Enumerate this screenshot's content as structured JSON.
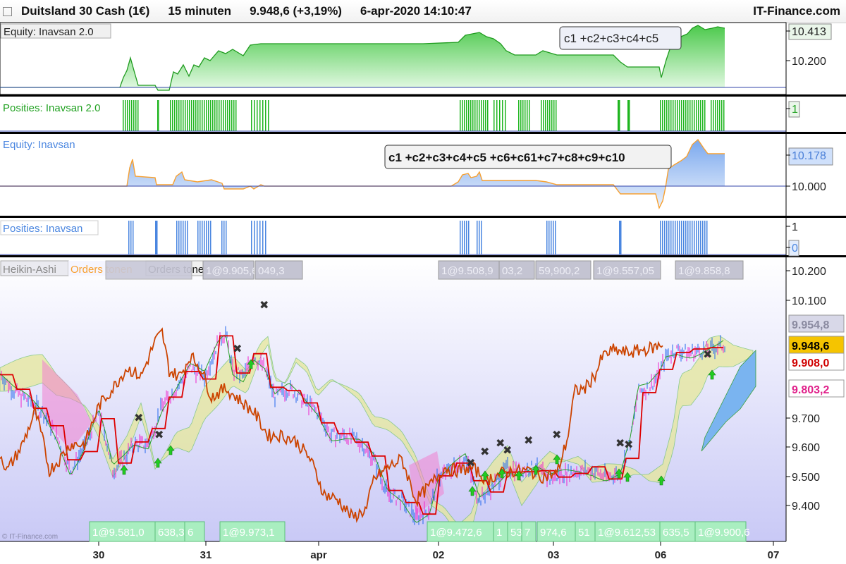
{
  "header": {
    "instrument": "Duitsland 30 Cash (1€)",
    "timeframe": "15 minuten",
    "quote": "9.948,6 (+3,19%)",
    "datetime": "6-apr-2020 14:10:47",
    "brand": "IT-Finance.com"
  },
  "panels": {
    "equity2": {
      "label": "Equity: Inavsan 2.0",
      "tooltip": "c1 +c2+c3+c4+c5",
      "axis": [
        "10.413",
        "10.200"
      ]
    },
    "pos2": {
      "label": "Posities: Inavsan 2.0",
      "axis": [
        "1"
      ]
    },
    "equity": {
      "label": "Equity: Inavsan",
      "tooltip": "c1 +c2+c3+c4+c5 +c6+c61+c7+c8+c9+c10",
      "axis": [
        "10.178",
        "10.000"
      ]
    },
    "pos": {
      "label": "Posities: Inavsan",
      "axis": [
        "1",
        "0"
      ]
    },
    "main": {
      "labels": [
        "Heikin-Ashi",
        "Orders tonen",
        "Orders tonen"
      ],
      "top_orders": [
        "1@9.905,6",
        "049,3",
        "1@9.508,9",
        "03,2",
        "59,900,2",
        "1@9.557,05",
        "1@9.858,8"
      ],
      "bottom_orders": [
        "1@9.581,0",
        "638,3",
        "6",
        "1@9.973,1",
        "1@9.472,6",
        "1",
        "53",
        "7",
        "974,6",
        "51",
        "1@9.612,53",
        "635,5",
        "1@9.900,6"
      ],
      "price_badges": [
        {
          "text": "9.954,8",
          "bg": "#d8d8e8",
          "fg": "#8a8aa0"
        },
        {
          "text": "9.948,6",
          "bg": "#f5c400",
          "fg": "#000000"
        },
        {
          "text": "9.908,0",
          "bg": "#ffffff",
          "fg": "#d00000"
        },
        {
          "text": "9.803,2",
          "bg": "#ffffff",
          "fg": "#e0208a"
        }
      ],
      "axis": [
        "10.200",
        "10.100",
        "9.700",
        "9.600",
        "9.500",
        "9.400"
      ]
    },
    "xaxis": [
      "30",
      "31",
      "apr",
      "02",
      "03",
      "06",
      "07"
    ],
    "copyright": "© IT-Finance.com"
  },
  "colors": {
    "equity_green": "#22aa22",
    "equity_fill_green": "#a8e6a8",
    "pos_green": "#22bb22",
    "equity_blue": "#4a7fd8",
    "pos_blue": "#4a86e0",
    "orange": "#f7a030",
    "price_orange": "#cc4400",
    "kijun": "#dd0000",
    "ha_blue": "#2266ee",
    "ha_magenta": "#ee22cc"
  },
  "chart_data": [
    {
      "type": "area",
      "title": "Equity: Inavsan 2.0",
      "y_ticks": [
        10200,
        10413
      ],
      "x": [
        "30",
        "31",
        "apr",
        "02",
        "03",
        "06"
      ],
      "series": [
        {
          "name": "Equity: Inavsan 2.0",
          "values": [
            10110,
            10130,
            10350,
            10310,
            10280,
            10413
          ]
        }
      ]
    },
    {
      "type": "area",
      "title": "Equity: Inavsan",
      "y_ticks": [
        10000,
        10178
      ],
      "x": [
        "30",
        "31",
        "apr",
        "02",
        "03",
        "06"
      ],
      "series": [
        {
          "name": "Equity: Inavsan",
          "values": [
            10000,
            10030,
            10000,
            10060,
            10000,
            10178
          ]
        }
      ]
    },
    {
      "type": "line",
      "title": "Heikin-Ashi",
      "y_ticks": [
        9400,
        9500,
        9600,
        9700,
        10100,
        10200
      ],
      "ylim": [
        9330,
        10230
      ],
      "x": [
        "30",
        "31",
        "apr",
        "02",
        "03",
        "06",
        "07"
      ],
      "series": [
        {
          "name": "Heikin-Ashi",
          "values": [
            9780,
            9560,
            9880,
            9470,
            9560,
            9760,
            9948.6
          ]
        }
      ],
      "levels": [
        9954.8,
        9948.6,
        9908.0,
        9803.2
      ]
    }
  ]
}
